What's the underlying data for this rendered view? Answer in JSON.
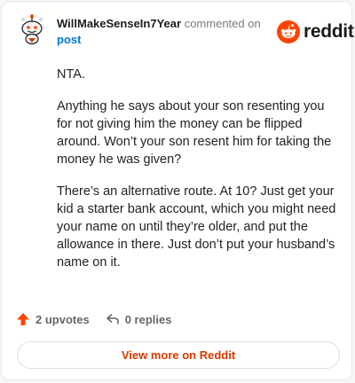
{
  "comment": {
    "username": "WillMakeSenseIn7Year",
    "commented_text": "commented on",
    "post_link": "post",
    "brand": "reddit",
    "paragraphs": [
      "NTA.",
      "Anything he says about your son resenting you for not giving him the money can be flipped around. Won’t your son resent him for taking the money he was given?",
      "There’s an alternative route. At 10? Just get your kid a starter bank account, which you might need your name on until they’re older, and put the allowance in there. Just don’t put your husband’s name on it."
    ],
    "upvotes_label": "2 upvotes",
    "replies_label": "0 replies",
    "view_more_label": "View more on Reddit"
  },
  "icons": {
    "avatar": "snoo-avatar-icon",
    "brand": "reddit-logo-icon",
    "upvote": "upvote-arrow-icon",
    "reply": "reply-arrow-icon"
  },
  "colors": {
    "brand_orange": "#ff4500",
    "upvote_red": "#ff4500",
    "link_blue": "#0079d3",
    "button_text": "#d93a00"
  }
}
